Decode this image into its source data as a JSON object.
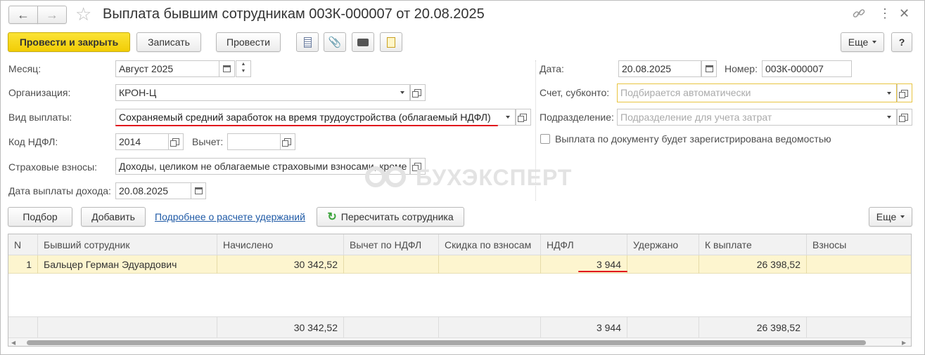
{
  "window": {
    "title": "Выплата бывшим сотрудникам 003К-000007 от 20.08.2025"
  },
  "toolbar": {
    "post_close": "Провести и закрыть",
    "save": "Записать",
    "post": "Провести",
    "more": "Еще",
    "help": "?"
  },
  "form": {
    "month": {
      "label": "Месяц:",
      "value": "Август 2025"
    },
    "org": {
      "label": "Организация:",
      "value": "КРОН-Ц"
    },
    "pay_type": {
      "label": "Вид выплаты:",
      "value": "Сохраняемый средний заработок на время трудоустройства (облагаемый НДФЛ)"
    },
    "ndfl_code": {
      "label": "Код НДФЛ:",
      "value": "2014"
    },
    "deduction": {
      "label": "Вычет:",
      "value": ""
    },
    "insurance": {
      "label": "Страховые взносы:",
      "value": "Доходы, целиком не облагаемые страховыми взносами, кроме"
    },
    "income_date": {
      "label": "Дата выплаты дохода:",
      "value": "20.08.2025"
    },
    "date": {
      "label": "Дата:",
      "value": "20.08.2025"
    },
    "number": {
      "label": "Номер:",
      "value": "003К-000007"
    },
    "account": {
      "label": "Счет, субконто:",
      "placeholder": "Подбирается автоматически"
    },
    "division": {
      "label": "Подразделение:",
      "placeholder": "Подразделение для учета затрат"
    },
    "statement_checkbox": {
      "label": "Выплата по документу будет зарегистрирована ведомостью",
      "checked": false
    }
  },
  "watermark": "БУХЭКСПЕРТ",
  "table_toolbar": {
    "pick": "Подбор",
    "add": "Добавить",
    "link": "Подробнее о расчете удержаний",
    "recalc": "Пересчитать сотрудника",
    "more": "Еще"
  },
  "table": {
    "headers": [
      "N",
      "Бывший сотрудник",
      "Начислено",
      "Вычет по НДФЛ",
      "Скидка по взносам",
      "НДФЛ",
      "Удержано",
      "К выплате",
      "Взносы"
    ],
    "rows": [
      [
        "1",
        "Бальцер Герман Эдуардович",
        "30 342,52",
        "",
        "",
        "3 944",
        "",
        "26 398,52",
        ""
      ]
    ],
    "totals": [
      "",
      "",
      "30 342,52",
      "",
      "",
      "3 944",
      "",
      "26 398,52",
      ""
    ]
  },
  "colors": {
    "accent": "#f5d20a",
    "highlight_row": "#fdf5cf",
    "red_underline": "#e0101c",
    "link": "#1f5aa6"
  }
}
